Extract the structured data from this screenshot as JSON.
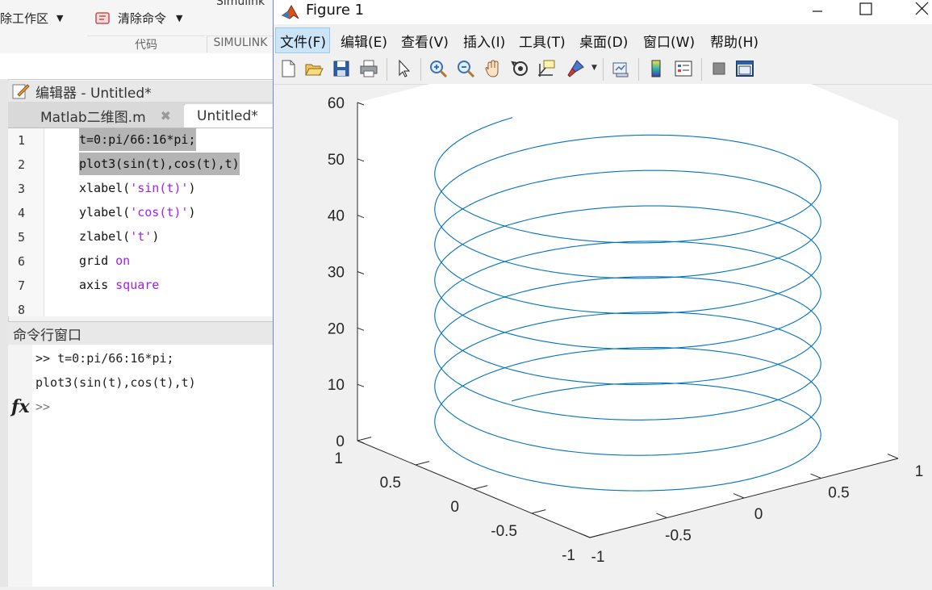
{
  "ribbon": {
    "clear_workspace_label": "除工作区",
    "clear_commands_label": "清除命令",
    "simulink_top_label": "Simulink",
    "section_code": "代码",
    "section_simulink": "SIMULINK"
  },
  "editor": {
    "title": "编辑器 - Untitled*",
    "tabs": [
      {
        "label": "Matlab二维图.m",
        "active": false
      },
      {
        "label": "Untitled*",
        "active": true
      }
    ],
    "lines": [
      {
        "num": "1",
        "code": "t=0:pi/66:16*pi;"
      },
      {
        "num": "2",
        "code": "plot3(sin(t),cos(t),t)"
      },
      {
        "num": "3",
        "pre": "xlabel(",
        "str": "'sin(t)'",
        "post": ")"
      },
      {
        "num": "4",
        "pre": "ylabel(",
        "str": "'cos(t)'",
        "post": ")"
      },
      {
        "num": "5",
        "pre": "zlabel(",
        "str": "'t'",
        "post": ")"
      },
      {
        "num": "6",
        "pre": "grid ",
        "str": "on",
        "post": ""
      },
      {
        "num": "7",
        "pre": "axis ",
        "str": "square",
        "post": ""
      },
      {
        "num": "8",
        "code": ""
      }
    ]
  },
  "command_window": {
    "title": "命令行窗口",
    "line1": ">> t=0:pi/66:16*pi;",
    "line2": "plot3(sin(t),cos(t),t)",
    "prompt": ">>",
    "fx": "fx"
  },
  "figure": {
    "title": "Figure 1",
    "menus": [
      "文件(F)",
      "编辑(E)",
      "查看(V)",
      "插入(I)",
      "工具(T)",
      "桌面(D)",
      "窗口(W)",
      "帮助(H)"
    ],
    "toolbar_icons": [
      "new-figure-icon",
      "open-file-icon",
      "save-icon",
      "print-icon",
      "select-arrow-icon",
      "zoom-in-icon",
      "zoom-out-icon",
      "pan-icon",
      "rotate-3d-icon",
      "data-cursor-icon",
      "brush-icon",
      "link-plot-icon",
      "colorbar-icon",
      "legend-icon",
      "hide-plot-tools-icon",
      "show-plot-tools-icon"
    ],
    "line_color": "#0072bd"
  },
  "chart_data": {
    "type": "line",
    "projection": "3d",
    "function": "x=sin(t), y=cos(t), z=t, t=0:pi/66:16*pi",
    "t_range": [
      0,
      50.27
    ],
    "xlim": [
      -1,
      1
    ],
    "ylim": [
      -1,
      1
    ],
    "zlim": [
      0,
      60
    ],
    "x_ticks": [
      "-1",
      "-0.5",
      "0",
      "0.5",
      "1"
    ],
    "y_ticks": [
      "-1",
      "-0.5",
      "0",
      "0.5",
      "1"
    ],
    "z_ticks": [
      "0",
      "10",
      "20",
      "30",
      "40",
      "50",
      "60"
    ],
    "grid": false
  }
}
